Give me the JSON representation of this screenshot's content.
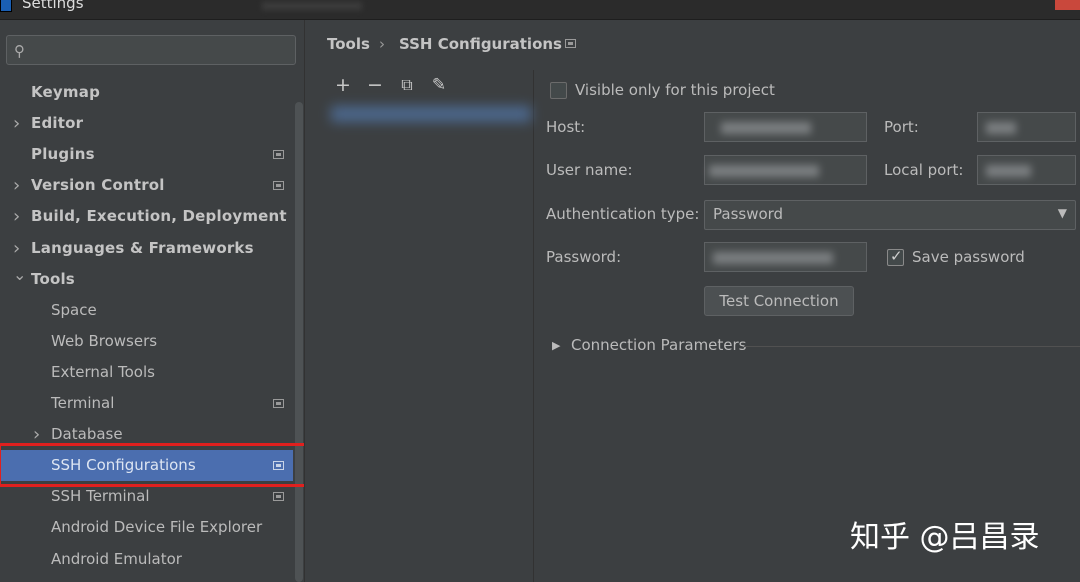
{
  "window": {
    "title": "Settings"
  },
  "search": {
    "placeholder": ""
  },
  "sidebar": {
    "items": [
      {
        "label": "Keymap",
        "level": 0,
        "arrow": "",
        "badge": false
      },
      {
        "label": "Editor",
        "level": 0,
        "arrow": ">",
        "badge": false
      },
      {
        "label": "Plugins",
        "level": 0,
        "arrow": "",
        "badge": true
      },
      {
        "label": "Version Control",
        "level": 0,
        "arrow": ">",
        "badge": true
      },
      {
        "label": "Build, Execution, Deployment",
        "level": 0,
        "arrow": ">",
        "badge": false
      },
      {
        "label": "Languages & Frameworks",
        "level": 0,
        "arrow": ">",
        "badge": false
      },
      {
        "label": "Tools",
        "level": 0,
        "arrow": "v",
        "badge": false
      },
      {
        "label": "Space",
        "level": 1,
        "arrow": "",
        "badge": false
      },
      {
        "label": "Web Browsers",
        "level": 1,
        "arrow": "",
        "badge": false
      },
      {
        "label": "External Tools",
        "level": 1,
        "arrow": "",
        "badge": false
      },
      {
        "label": "Terminal",
        "level": 1,
        "arrow": "",
        "badge": true
      },
      {
        "label": "Database",
        "level": 1,
        "arrow": ">",
        "badge": false
      },
      {
        "label": "SSH Configurations",
        "level": 1,
        "arrow": "",
        "badge": true,
        "selected": true
      },
      {
        "label": "SSH Terminal",
        "level": 1,
        "arrow": "",
        "badge": true
      },
      {
        "label": "Android Device File Explorer",
        "level": 1,
        "arrow": "",
        "badge": false
      },
      {
        "label": "Android Emulator",
        "level": 1,
        "arrow": "",
        "badge": false
      }
    ]
  },
  "breadcrumb": {
    "parent": "Tools",
    "separator": "›",
    "current": "SSH Configurations"
  },
  "list_toolbar": {
    "add": "+",
    "remove": "−",
    "copy": "⧉",
    "edit": "✎"
  },
  "form": {
    "visible_only_label": "Visible only for this project",
    "visible_only_checked": false,
    "host_label": "Host:",
    "port_label": "Port:",
    "username_label": "User name:",
    "local_port_label": "Local port:",
    "auth_type_label": "Authentication type:",
    "auth_type_value": "Password",
    "password_label": "Password:",
    "save_password_label": "Save password",
    "save_password_checked": true,
    "test_connection_label": "Test Connection",
    "connection_params_label": "Connection Parameters"
  },
  "watermark": "知乎 @吕昌录",
  "colors": {
    "background": "#3c3f41",
    "selection": "#4b6eaf",
    "highlight": "#e0201e"
  }
}
